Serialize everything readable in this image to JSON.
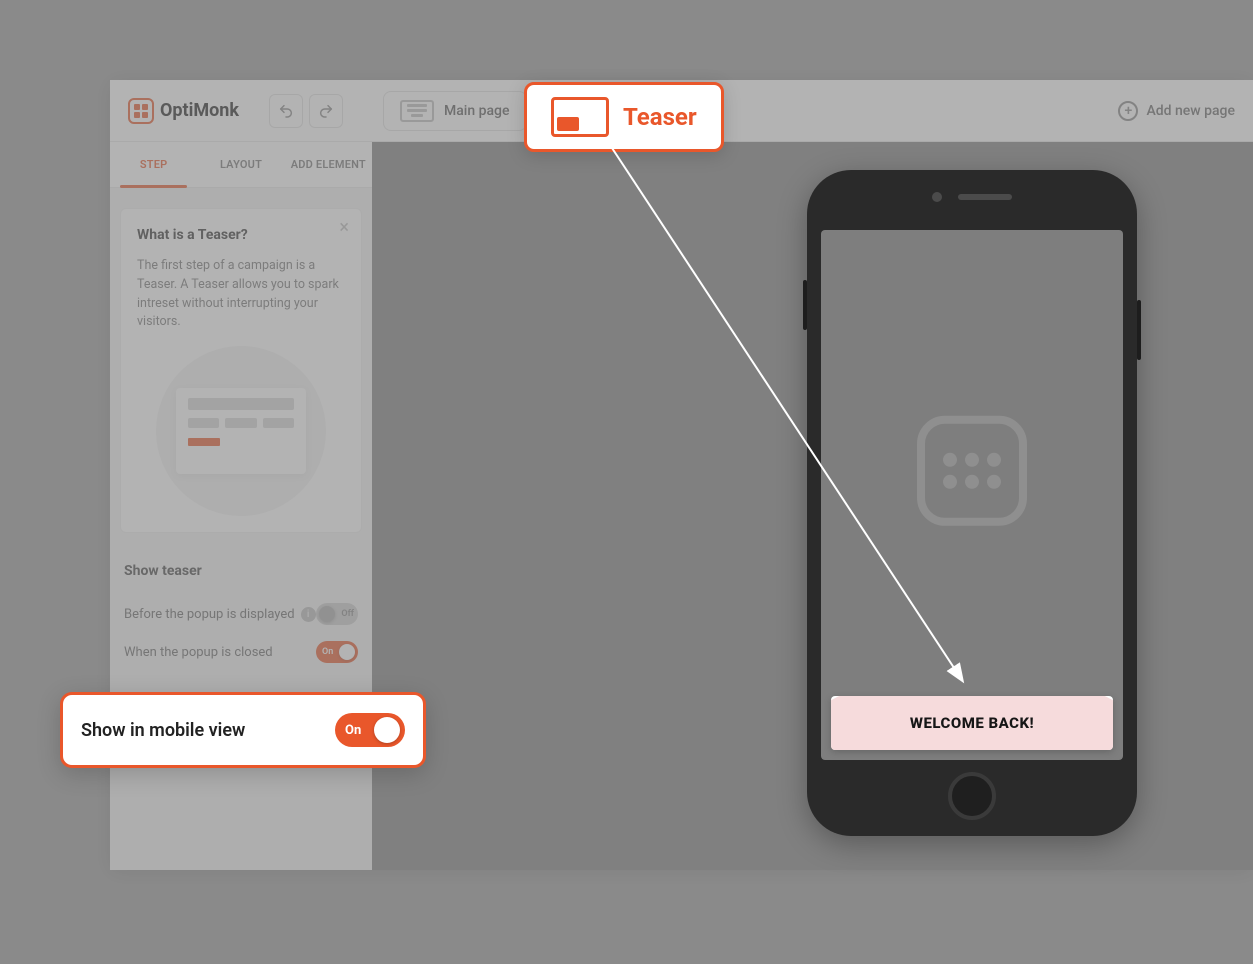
{
  "header": {
    "brand": "OptiMonk",
    "main_page_label": "Main page",
    "teaser_label": "Teaser",
    "add_page_label": "Add new page"
  },
  "sidebar": {
    "tabs": {
      "step": "STEP",
      "layout": "LAYOUT",
      "add_element": "ADD ELEMENT"
    },
    "info_title": "What is a Teaser?",
    "info_body": "The first step of a campaign is a Teaser. A Teaser allows you to spark intreset without interrupting your visitors.",
    "show_teaser_title": "Show teaser",
    "opt_before": "Before the popup is displayed",
    "opt_before_state": "Off",
    "opt_closed": "When the popup is closed",
    "opt_closed_state": "On"
  },
  "highlight": {
    "mobile_label": "Show in mobile view",
    "mobile_state": "On"
  },
  "preview": {
    "teaser_text": "WELCOME BACK!"
  }
}
